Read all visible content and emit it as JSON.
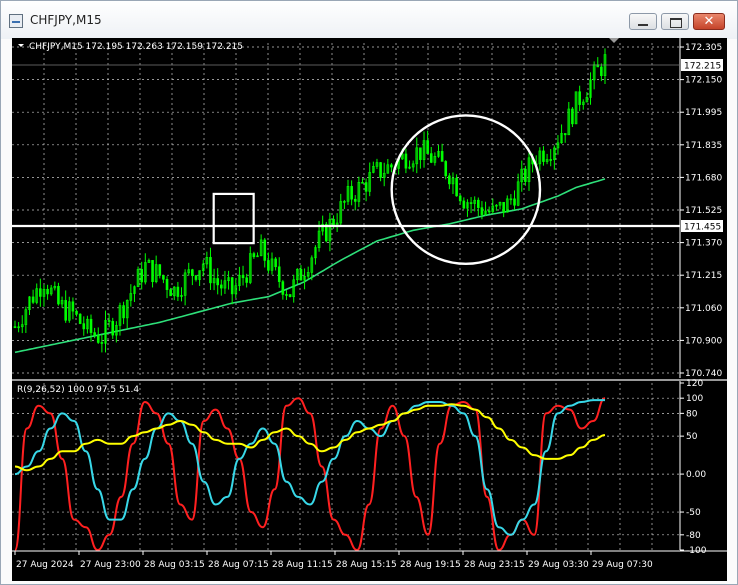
{
  "window": {
    "title": "CHFJPY,M15",
    "close_glyph": "✕",
    "icons": [
      "chart-window-icon",
      "minimize-icon",
      "maximize-icon",
      "close-icon"
    ]
  },
  "colors": {
    "background": "#000000",
    "grid": "#c8c8c8",
    "text": "#ffffff",
    "candles": "#00ff00",
    "moving_average": "#2ee07a",
    "indicator_fast": "#ff2020",
    "indicator_slow": "#38d8e8",
    "indicator_signal": "#ffff00",
    "annotation": "#ffffff"
  },
  "main_panel": {
    "header": "CHFJPY,M15  172.195 172.263 172.159 172.215",
    "price_labels": [
      "172.305",
      "172.150",
      "171.995",
      "171.835",
      "171.680",
      "171.525",
      "171.370",
      "171.215",
      "171.060",
      "170.900",
      "170.740"
    ],
    "current_price": "172.215",
    "level_price": "171.455"
  },
  "indicator_panel": {
    "header": "R(9,26,52) 100.0 97.5 51.4",
    "labels": [
      "120",
      "100",
      "80",
      "50",
      "0.00",
      "-50",
      "-80",
      "-100"
    ]
  },
  "time_axis": [
    "27 Aug 2024",
    "27 Aug 23:00",
    "28 Aug 03:15",
    "28 Aug 07:15",
    "28 Aug 11:15",
    "28 Aug 15:15",
    "28 Aug 19:15",
    "28 Aug 23:15",
    "29 Aug 03:30",
    "29 Aug 07:30"
  ],
  "chart_data": [
    {
      "type": "candlestick",
      "symbol": "CHFJPY",
      "timeframe": "M15",
      "last_bar": {
        "open": 172.195,
        "high": 172.263,
        "low": 172.159,
        "close": 172.215
      },
      "ylim": [
        170.74,
        172.305
      ],
      "horizontal_line": 171.455,
      "close_path": [
        [
          0,
          170.98
        ],
        [
          4,
          171.1
        ],
        [
          8,
          171.2
        ],
        [
          12,
          171.08
        ],
        [
          16,
          171.04
        ],
        [
          20,
          170.96
        ],
        [
          24,
          170.93
        ],
        [
          28,
          171.02
        ],
        [
          32,
          171.14
        ],
        [
          36,
          171.26
        ],
        [
          40,
          171.22
        ],
        [
          44,
          171.15
        ],
        [
          48,
          171.22
        ],
        [
          52,
          171.28
        ],
        [
          56,
          171.18
        ],
        [
          60,
          171.14
        ],
        [
          64,
          171.24
        ],
        [
          68,
          171.33
        ],
        [
          72,
          171.22
        ],
        [
          76,
          171.14
        ],
        [
          80,
          171.26
        ],
        [
          84,
          171.38
        ],
        [
          88,
          171.48
        ],
        [
          92,
          171.58
        ],
        [
          96,
          171.64
        ],
        [
          100,
          171.7
        ],
        [
          104,
          171.73
        ],
        [
          108,
          171.78
        ],
        [
          112,
          171.8
        ],
        [
          116,
          171.76
        ],
        [
          120,
          171.7
        ],
        [
          124,
          171.58
        ],
        [
          128,
          171.54
        ],
        [
          132,
          171.51
        ],
        [
          136,
          171.55
        ],
        [
          140,
          171.66
        ],
        [
          144,
          171.78
        ],
        [
          148,
          171.82
        ],
        [
          152,
          171.92
        ],
        [
          156,
          172.05
        ],
        [
          160,
          172.15
        ],
        [
          163,
          172.22
        ]
      ],
      "moving_average_path": [
        [
          0,
          170.86
        ],
        [
          20,
          170.93
        ],
        [
          40,
          171.0
        ],
        [
          60,
          171.09
        ],
        [
          70,
          171.12
        ],
        [
          80,
          171.19
        ],
        [
          90,
          171.29
        ],
        [
          100,
          171.38
        ],
        [
          110,
          171.43
        ],
        [
          120,
          171.46
        ],
        [
          130,
          171.5
        ],
        [
          140,
          171.53
        ],
        [
          150,
          171.59
        ],
        [
          155,
          171.63
        ],
        [
          163,
          171.67
        ]
      ],
      "annotations": [
        {
          "shape": "rectangle",
          "x_range": [
            56,
            64
          ],
          "y_range": [
            171.37,
            171.6
          ]
        },
        {
          "shape": "circle",
          "center": [
            124,
            171.62
          ],
          "radius_bars": 18
        }
      ]
    },
    {
      "type": "line",
      "title": "R(9,26,52)",
      "ylim": [
        -100,
        120
      ],
      "series": [
        {
          "name": "R(9)",
          "last": 100.0,
          "values": [
            -100,
            60,
            90,
            80,
            20,
            -60,
            -70,
            -100,
            -80,
            -30,
            40,
            95,
            80,
            40,
            -40,
            -60,
            70,
            85,
            60,
            20,
            -50,
            -70,
            -20,
            90,
            100,
            80,
            10,
            -60,
            -80,
            -100,
            -40,
            60,
            90,
            50,
            -30,
            -80,
            40,
            90,
            95,
            85,
            -30,
            -100,
            -80,
            -60,
            -80,
            80,
            90,
            85,
            60,
            70,
            100
          ]
        },
        {
          "name": "R(26)",
          "last": 97.5,
          "values": [
            0,
            10,
            30,
            60,
            80,
            70,
            30,
            -20,
            -60,
            -60,
            -20,
            20,
            60,
            80,
            70,
            40,
            -10,
            -40,
            -30,
            20,
            40,
            60,
            40,
            -10,
            -30,
            -40,
            -10,
            20,
            50,
            70,
            60,
            50,
            70,
            80,
            90,
            95,
            95,
            90,
            80,
            50,
            -20,
            -70,
            -80,
            -60,
            -40,
            30,
            80,
            90,
            95,
            97.5,
            97.5
          ]
        },
        {
          "name": "R(52)",
          "last": 51.4,
          "values": [
            10,
            5,
            10,
            20,
            30,
            30,
            40,
            45,
            40,
            40,
            50,
            55,
            60,
            65,
            70,
            65,
            55,
            45,
            40,
            40,
            35,
            45,
            55,
            60,
            50,
            40,
            30,
            35,
            45,
            55,
            60,
            65,
            70,
            80,
            85,
            90,
            90,
            92,
            90,
            85,
            75,
            60,
            45,
            35,
            25,
            20,
            20,
            25,
            35,
            45,
            51.4
          ]
        }
      ]
    }
  ]
}
